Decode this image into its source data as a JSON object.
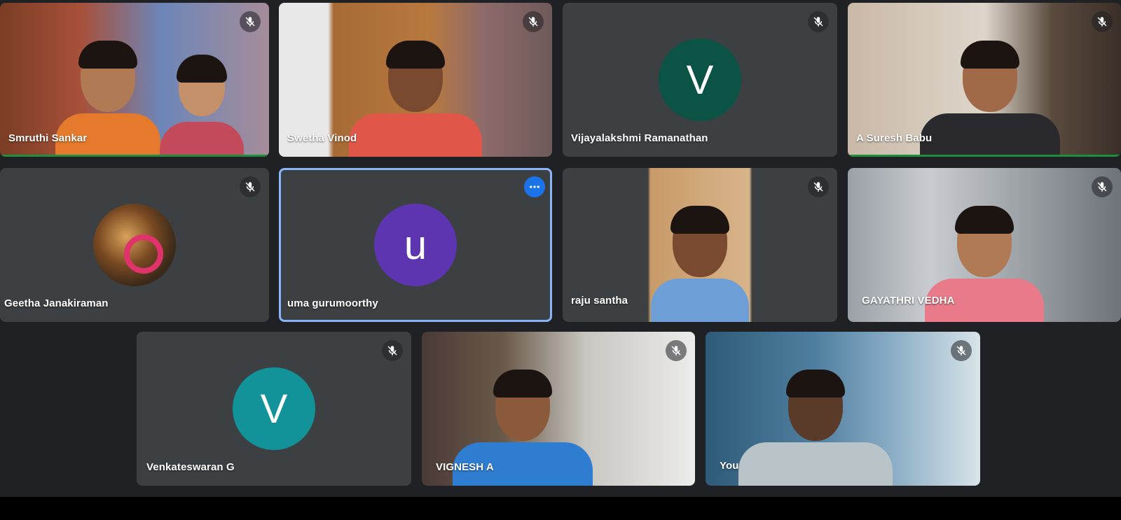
{
  "participants": [
    {
      "name": "Smruthi Sankar",
      "muted": true
    },
    {
      "name": "Swetha Vinod",
      "muted": true
    },
    {
      "name": "Vijayalakshmi Ramanathan",
      "initial": "V",
      "avatar_color": "#0b5345",
      "muted": true
    },
    {
      "name": "A Suresh Babu",
      "muted": true
    },
    {
      "name": "Geetha Janakiraman",
      "muted": true
    },
    {
      "name": "uma gurumoorthy",
      "initial": "u",
      "avatar_color": "#5e35b1",
      "active": true
    },
    {
      "name": "raju santha",
      "muted": true
    },
    {
      "name": "GAYATHRI VEDHA",
      "muted": true
    },
    {
      "name": "Venkateswaran G",
      "initial": "V",
      "avatar_color": "#12939a",
      "muted": true
    },
    {
      "name": "VIGNESH A",
      "muted": true
    },
    {
      "name": "You",
      "muted": true
    }
  ],
  "icons": {
    "mute": "mic-off-icon",
    "more": "more-options-icon"
  },
  "colors": {
    "background": "#202124",
    "tile": "#3c4043",
    "active_border": "#8ab4f8",
    "more_button": "#1a73e8"
  }
}
